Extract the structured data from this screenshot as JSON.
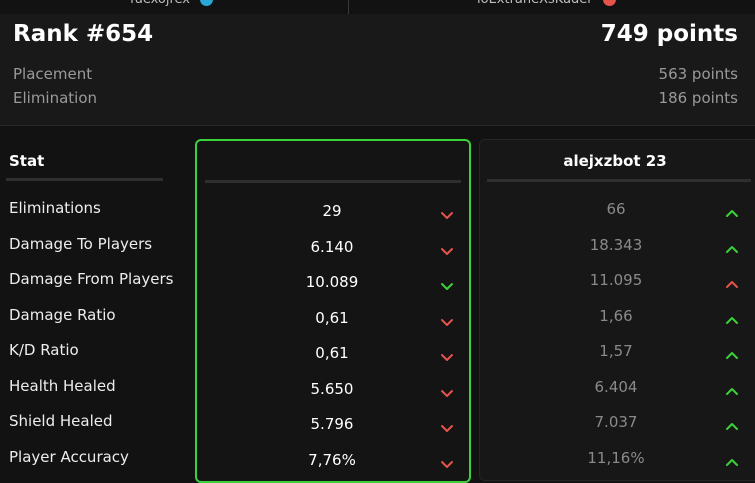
{
  "header": {
    "player1_name": "fuexojrex",
    "player2_name": "ioExtraneXsKader",
    "rank_label": "Rank #654",
    "total_points": "749 points",
    "breakdown": [
      {
        "label": "Placement",
        "value": "563 points"
      },
      {
        "label": "Elimination",
        "value": "186 points"
      }
    ]
  },
  "table": {
    "stat_header": "Stat",
    "mine_header": "",
    "opponent_header": "alejxzbot 23",
    "rows": [
      {
        "stat": "Eliminations",
        "mine": "29",
        "mine_trend": "down",
        "opponent": "66",
        "opponent_trend": "up"
      },
      {
        "stat": "Damage To Players",
        "mine": "6.140",
        "mine_trend": "down",
        "opponent": "18.343",
        "opponent_trend": "up"
      },
      {
        "stat": "Damage From Players",
        "mine": "10.089",
        "mine_trend": "down-good",
        "opponent": "11.095",
        "opponent_trend": "up-bad"
      },
      {
        "stat": "Damage Ratio",
        "mine": "0,61",
        "mine_trend": "down",
        "opponent": "1,66",
        "opponent_trend": "up"
      },
      {
        "stat": "K/D Ratio",
        "mine": "0,61",
        "mine_trend": "down",
        "opponent": "1,57",
        "opponent_trend": "up"
      },
      {
        "stat": "Health Healed",
        "mine": "5.650",
        "mine_trend": "down",
        "opponent": "6.404",
        "opponent_trend": "up"
      },
      {
        "stat": "Shield Healed",
        "mine": "5.796",
        "mine_trend": "down",
        "opponent": "7.037",
        "opponent_trend": "up"
      },
      {
        "stat": "Player Accuracy",
        "mine": "7,76%",
        "mine_trend": "down",
        "opponent": "11,16%",
        "opponent_trend": "up"
      }
    ]
  },
  "colors": {
    "highlight": "#3ad13a",
    "arrow_bad": "#e5534b",
    "arrow_good": "#3ad13a",
    "avatar_dot_1": "#2aa7d6",
    "avatar_dot_2": "#e5534b"
  }
}
